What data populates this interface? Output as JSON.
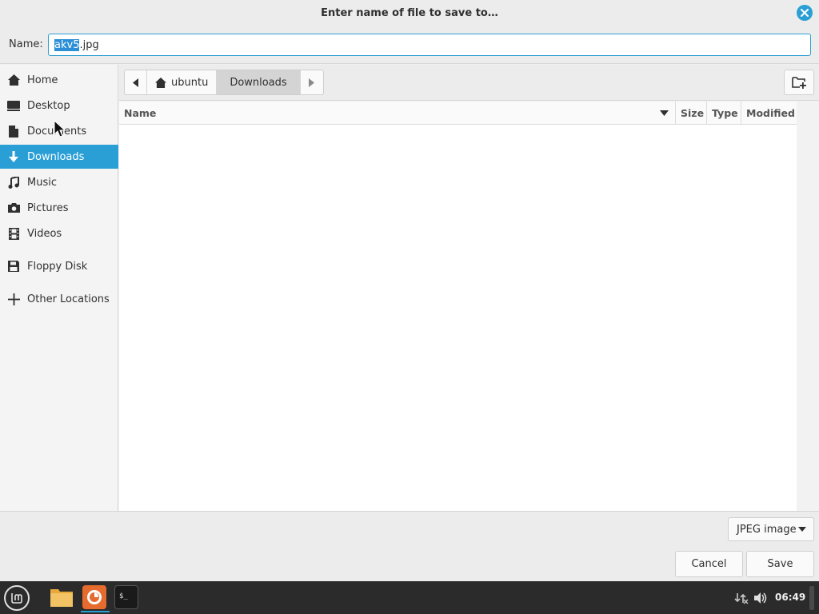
{
  "dialog": {
    "title": "Enter name of file to save to…",
    "accent_color": "#2a9fd6"
  },
  "name_field": {
    "label": "Name:",
    "value_selected": "akv5",
    "value_rest": ".jpg"
  },
  "sidebar": {
    "items": [
      {
        "label": "Home",
        "icon": "home-icon"
      },
      {
        "label": "Desktop",
        "icon": "desktop-icon"
      },
      {
        "label": "Documents",
        "icon": "document-icon"
      },
      {
        "label": "Downloads",
        "icon": "download-icon",
        "active": true
      },
      {
        "label": "Music",
        "icon": "music-icon"
      },
      {
        "label": "Pictures",
        "icon": "camera-icon"
      },
      {
        "label": "Videos",
        "icon": "film-icon"
      },
      {
        "label": "Floppy Disk",
        "icon": "floppy-icon"
      },
      {
        "label": "Other Locations",
        "icon": "plus-icon"
      }
    ]
  },
  "pathbar": {
    "crumbs": [
      "ubuntu",
      "Downloads"
    ]
  },
  "file_list": {
    "columns": [
      "Name",
      "Size",
      "Type",
      "Modified"
    ],
    "sort_column": "Name"
  },
  "footer": {
    "file_type": "JPEG image",
    "cancel_label": "Cancel",
    "save_label": "Save"
  },
  "taskbar": {
    "clock": "06:49",
    "apps": [
      "files-icon",
      "firefox-icon",
      "terminal-icon"
    ]
  }
}
